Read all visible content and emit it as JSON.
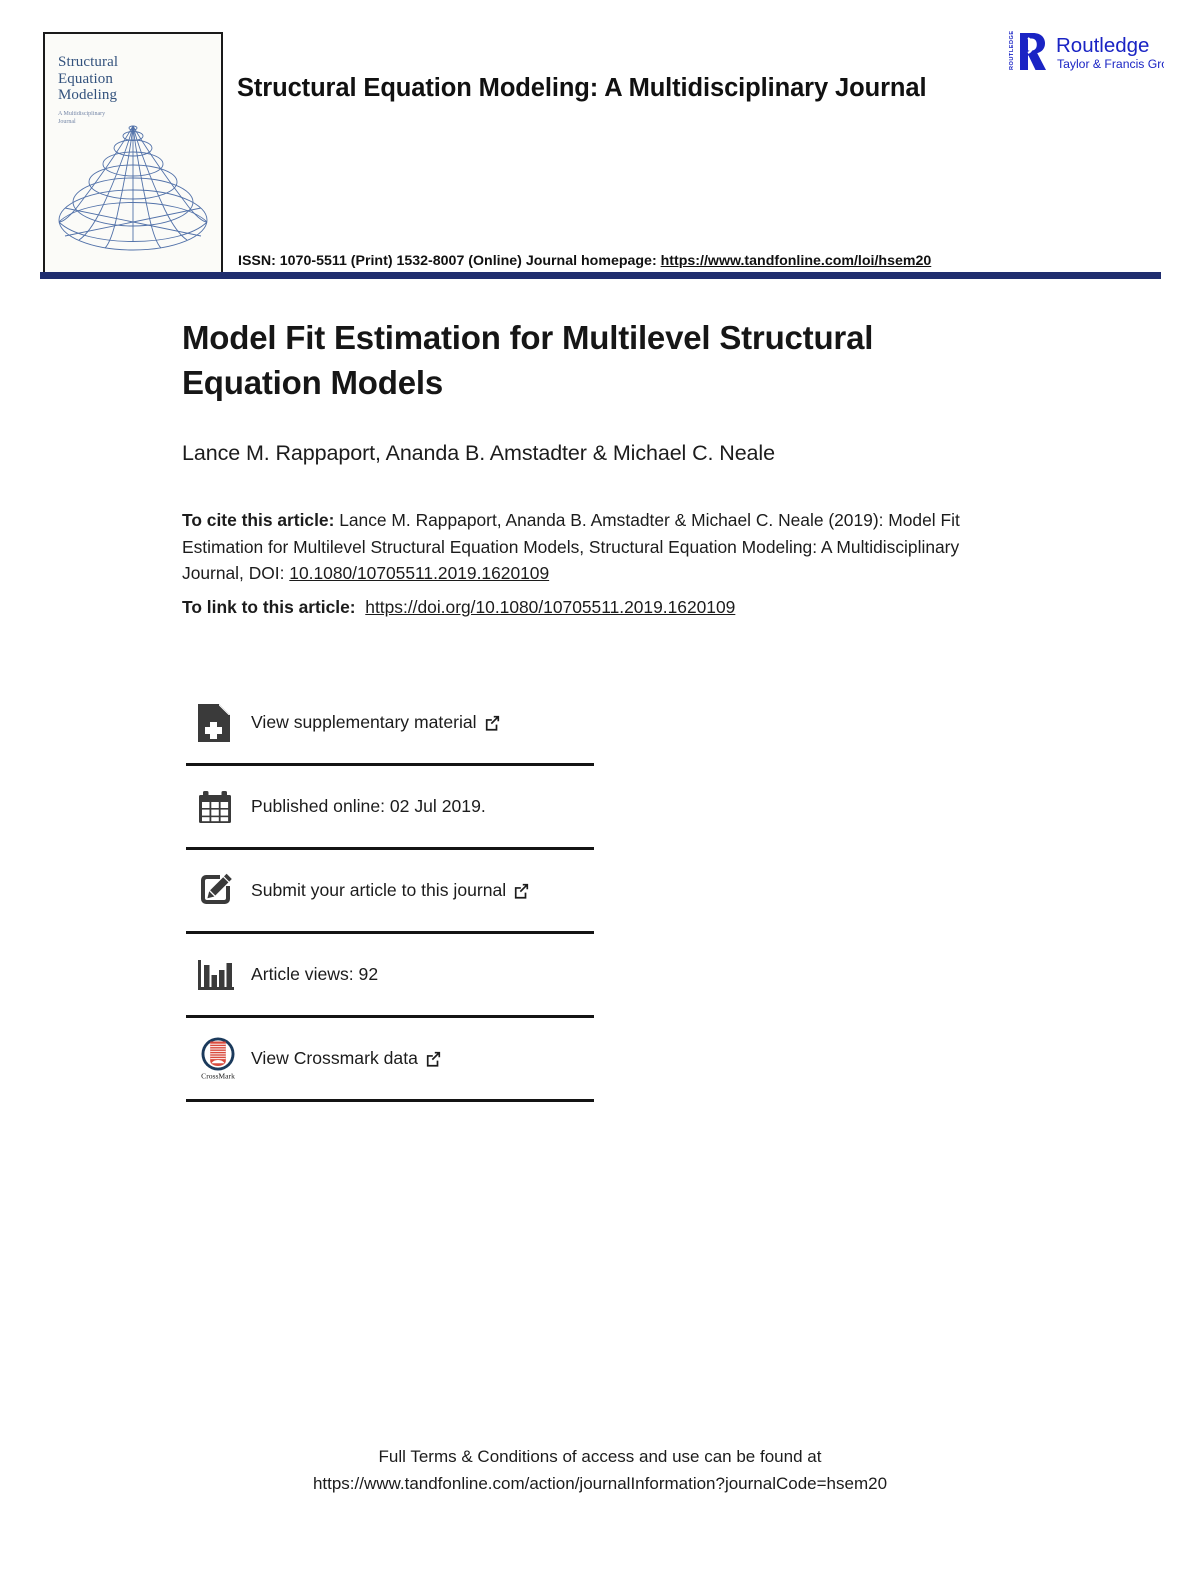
{
  "header": {
    "journal_title": "Structural Equation Modeling: A Multidisciplinary Journal",
    "issn_text": "ISSN: 1070-5511 (Print) 1532-8007 (Online) Journal homepage: ",
    "issn_homepage_url": "https://www.tandfonline.com/loi/hsem20",
    "rule_color": "#1f2d6e",
    "cover": {
      "title": "Structural\nEquation\nModeling",
      "subtitle": "A Multidisciplinary\nJournal",
      "art_color": "#4a6ba5"
    },
    "publisher": {
      "name": "Routledge",
      "group": "Taylor & Francis Group",
      "mark_text": "ROUTLEDGE",
      "color": "#1a24c4"
    }
  },
  "article": {
    "title": "Model Fit Estimation for Multilevel Structural Equation Models",
    "authors": "Lance M. Rappaport, Ananda B. Amstadter & Michael C. Neale",
    "cite_label": "To cite this article:",
    "cite_text": " Lance M. Rappaport, Ananda B. Amstadter & Michael C. Neale (2019): Model Fit Estimation for Multilevel Structural Equation Models, Structural Equation Modeling: A Multidisciplinary Journal, DOI: ",
    "cite_doi": "10.1080/10705511.2019.1620109",
    "link_label": "To link to this article:",
    "link_url": "https://doi.org/10.1080/10705511.2019.1620109"
  },
  "actions": [
    {
      "icon": "document-plus-icon",
      "label": "View supplementary material",
      "external": true
    },
    {
      "icon": "calendar-icon",
      "label": "Published online: 02 Jul 2019.",
      "external": false
    },
    {
      "icon": "pencil-square-icon",
      "label": "Submit your article to this journal",
      "external": true
    },
    {
      "icon": "bar-chart-icon",
      "label": "Article views: 92",
      "external": false
    },
    {
      "icon": "crossmark-icon",
      "label": "View Crossmark data",
      "external": true
    }
  ],
  "footer": {
    "line1": "Full Terms & Conditions of access and use can be found at",
    "line2": "https://www.tandfonline.com/action/journalInformation?journalCode=hsem20"
  }
}
